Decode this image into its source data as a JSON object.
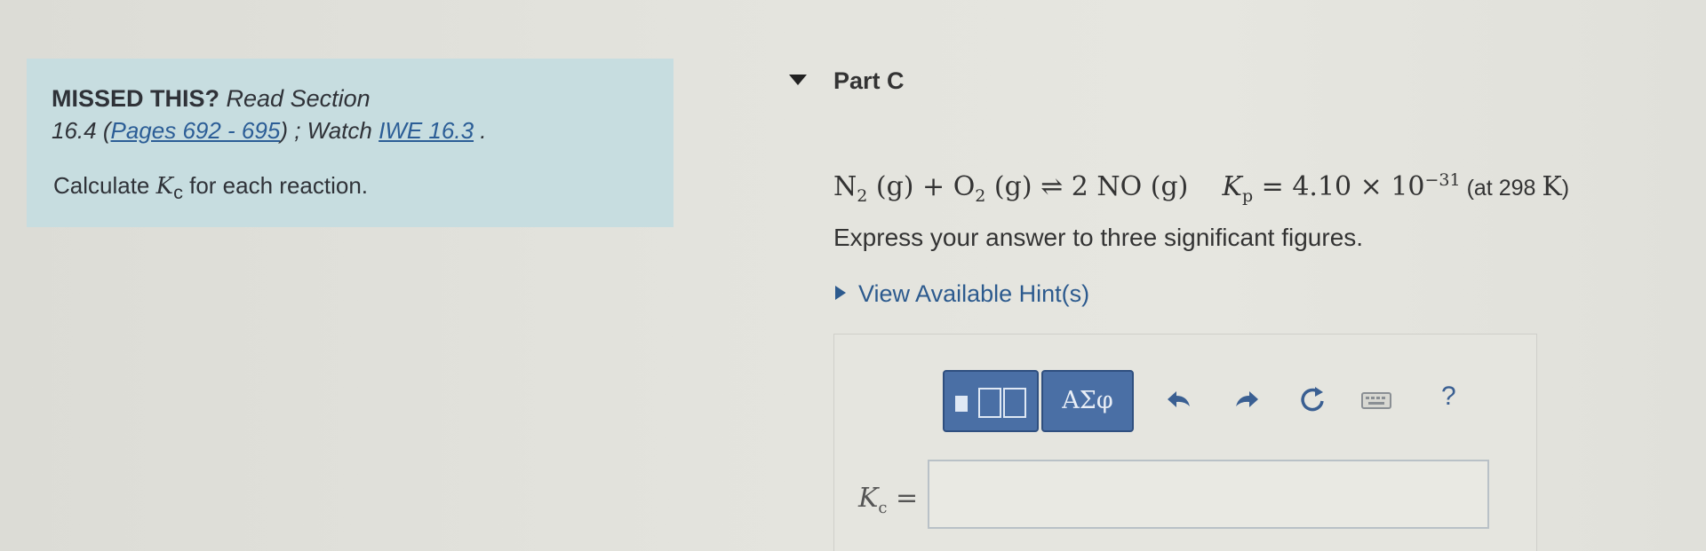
{
  "left": {
    "missed_bold": "MISSED THIS?",
    "missed_italic": "Read Section",
    "section_prefix": "16.4 (",
    "pages_link": "Pages 692 - 695",
    "section_mid": ") ; Watch ",
    "iwe_link": "IWE 16.3",
    "section_suffix": " .",
    "calc_pre": "Calculate ",
    "calc_var": "K",
    "calc_sub": "c",
    "calc_post": " for each reaction."
  },
  "part": {
    "title": "Part C",
    "equation": {
      "n": "N",
      "n_sub": "2",
      "g1": " (g) + O",
      "o_sub": "2",
      "g2": " (g) ⇌ 2 NO (g)",
      "kp": "K",
      "kp_sub": "p",
      "value": " = 4.10 × 10",
      "exp": "−31",
      "cond_pre": " (at 298 ",
      "cond_k": "K",
      "cond_post": ")"
    },
    "instruction": "Express your answer to three significant figures.",
    "hint": "View Available Hint(s)"
  },
  "toolbar": {
    "greek_label": "ΑΣφ",
    "help_label": "?",
    "icons": [
      "templates-icon",
      "undo-icon",
      "redo-icon",
      "reset-icon",
      "keyboard-icon",
      "help-icon"
    ]
  },
  "answer": {
    "label_var": "K",
    "label_sub": "c",
    "label_eq": " =",
    "value": ""
  },
  "colors": {
    "panel_bg": "#c7dde0",
    "link": "#2b5d96",
    "button_blue": "#4a6fa5"
  }
}
